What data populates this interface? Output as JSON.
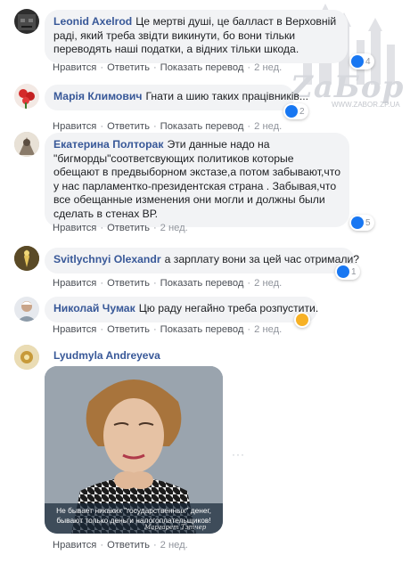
{
  "comments": [
    {
      "author": "Leonid Axelrod",
      "text": "Це мертві душі, це балласт в Верховній раді, який треба звідти викинути, бо вони тільки переводять наші податки, а відних тільки шкода.",
      "reactions": "4",
      "reaction_type": "like"
    },
    {
      "author": "Марія Климович",
      "text": "Гнати а шию таких працівників...",
      "reactions": "2",
      "reaction_type": "like"
    },
    {
      "author": "Екатерина Полторак",
      "text": "Эти данные надо на \"бигморды\"соответсвующих политиков которые обещают в предвыборном экстазе,а потом забывают,что у нас парламентко-президентская страна . Забывая,что все обещанные изменения они могли и должны были сделать в стенах ВР.",
      "reactions": "5",
      "reaction_type": "like"
    },
    {
      "author": "Svitlychnyi Olexandr",
      "text": "а зарплату вони за цей час отримали?",
      "reactions": "1",
      "reaction_type": "like"
    },
    {
      "author": "Николай Чумак",
      "text": "Цю раду негайно треба розпустити.",
      "reactions": "",
      "reaction_type": "haha"
    },
    {
      "author": "Lyudmyla Andreyeva",
      "text": "",
      "reactions": "",
      "reaction_type": "none"
    }
  ],
  "actions": {
    "like": "Нравится",
    "reply": "Ответить",
    "translate": "Показать перевод",
    "time": "2 нед."
  },
  "image_card": {
    "caption_line1": "Не бывает никаких \"государственных\" денег,",
    "caption_line2": "бывают только деньги налогоплательщиков!",
    "signature": "Маргарет Тэтчер"
  },
  "watermark": {
    "brand": "ZaБор",
    "url": "WWW.ZABOR.ZP.UA"
  },
  "colors": {
    "author": "#385898",
    "bubble": "#f2f3f5",
    "like": "#1877f2"
  }
}
